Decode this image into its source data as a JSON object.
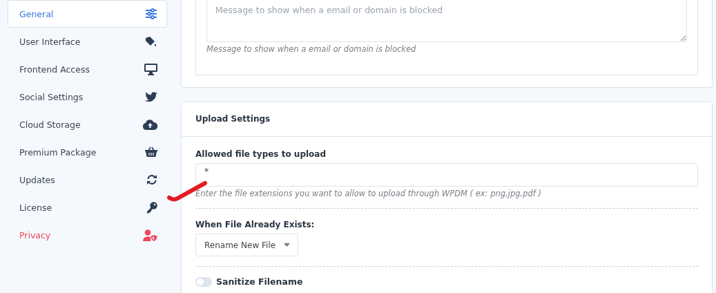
{
  "sidebar": {
    "items": [
      {
        "label": "General",
        "selected": true
      },
      {
        "label": "User Interface",
        "selected": false
      },
      {
        "label": "Frontend Access",
        "selected": false
      },
      {
        "label": "Social Settings",
        "selected": false
      },
      {
        "label": "Cloud Storage",
        "selected": false
      },
      {
        "label": "Premium Package",
        "selected": false
      },
      {
        "label": "Updates",
        "selected": false
      },
      {
        "label": "License",
        "selected": false
      },
      {
        "label": "Privacy",
        "selected": false,
        "kind": "danger"
      }
    ]
  },
  "blocked_message": {
    "placeholder": "Message to show when a email or domain is blocked",
    "hint": "Message to show when a email or domain is blocked"
  },
  "upload_settings": {
    "title": "Upload Settings",
    "allowed_types": {
      "label": "Allowed file types to upload",
      "value": "*",
      "hint": "Enter the file extensions you want to allow to upload through WPDM ( ex: png,jpg,pdf )"
    },
    "file_exists": {
      "label": "When File Already Exists:",
      "value": "Rename New File"
    },
    "sanitize": {
      "label": "Sanitize Filename",
      "on": false
    }
  }
}
